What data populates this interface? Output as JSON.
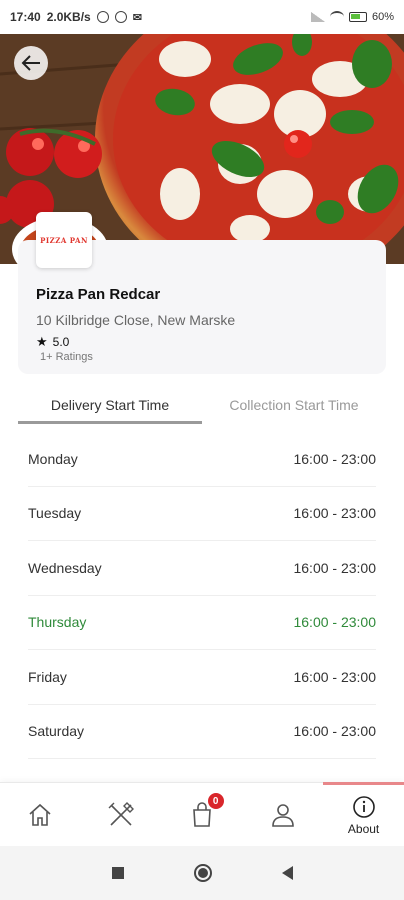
{
  "status_bar": {
    "time": "17:40",
    "speed": "2.0KB/s",
    "battery": "60%"
  },
  "restaurant": {
    "logo_text": "PIZZA PAN",
    "name": "Pizza Pan Redcar",
    "address": "10 Kilbridge Close, New Marske",
    "rating": "5.0",
    "ratings_count": "1+ Ratings"
  },
  "tabs": [
    {
      "label": "Delivery Start Time",
      "active": true
    },
    {
      "label": "Collection Start Time",
      "active": false
    }
  ],
  "hours": [
    {
      "day": "Monday",
      "time": "16:00 - 23:00"
    },
    {
      "day": "Tuesday",
      "time": "16:00 - 23:00"
    },
    {
      "day": "Wednesday",
      "time": "16:00 - 23:00"
    },
    {
      "day": "Thursday",
      "time": "16:00 - 23:00",
      "today": true
    },
    {
      "day": "Friday",
      "time": "16:00 - 23:00"
    },
    {
      "day": "Saturday",
      "time": "16:00 - 23:00"
    }
  ],
  "bottom_nav": {
    "cart_badge": "0",
    "about_label": "About",
    "items": [
      "home-icon",
      "fork-knife-icon",
      "shopping-bag-icon",
      "user-icon",
      "info-icon"
    ]
  },
  "colors": {
    "today": "#2f8a3a",
    "badge": "#d9262b",
    "active_nav_bar": "#e8878a",
    "brand_logo": "#e0342c"
  }
}
